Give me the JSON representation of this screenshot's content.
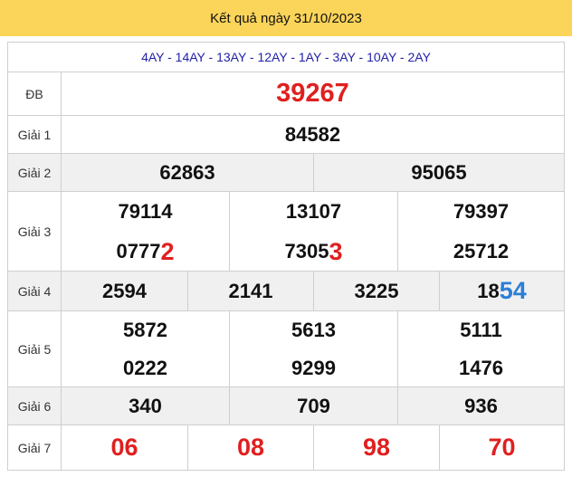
{
  "header": {
    "title": "Kết quả ngày 31/10/2023"
  },
  "codes": "4AY - 14AY - 13AY - 12AY - 1AY - 3AY - 10AY - 2AY",
  "prizes": {
    "db": {
      "label": "ĐB",
      "value": "39267"
    },
    "g1": {
      "label": "Giải 1",
      "value": "84582"
    },
    "g2": {
      "label": "Giải 2",
      "values": [
        "62863",
        "95065"
      ]
    },
    "g3": {
      "label": "Giải 3",
      "row1": [
        "79114",
        "13107",
        "79397"
      ],
      "row2": [
        {
          "base": "0777",
          "tail": "2"
        },
        {
          "base": "7305",
          "tail": "3"
        },
        {
          "base": "25712",
          "tail": ""
        }
      ]
    },
    "g4": {
      "label": "Giải 4",
      "values": [
        "2594",
        "2141",
        "3225"
      ],
      "last": {
        "base": "18",
        "tail": "54"
      }
    },
    "g5": {
      "label": "Giải 5",
      "row1": [
        "5872",
        "5613",
        "5111"
      ],
      "row2": [
        "0222",
        "9299",
        "1476"
      ]
    },
    "g6": {
      "label": "Giải 6",
      "values": [
        "340",
        "709",
        "936"
      ]
    },
    "g7": {
      "label": "Giải 7",
      "values": [
        "06",
        "08",
        "98",
        "70"
      ]
    }
  },
  "colors": {
    "header_bg": "#fbd45a",
    "highlight_red": "#e01f1f",
    "highlight_blue": "#2b7fd6",
    "code_text": "#1f1fa8"
  }
}
